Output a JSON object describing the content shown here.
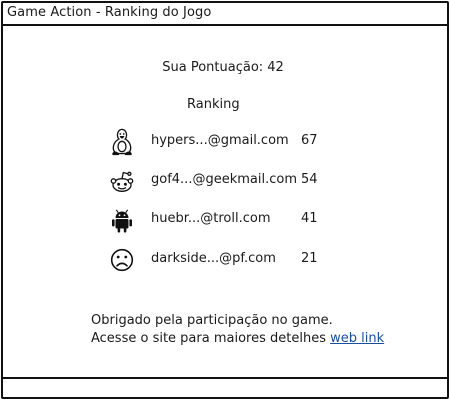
{
  "window": {
    "title": "Game Action - Ranking do Jogo"
  },
  "score": {
    "label": "Sua Pontuação:",
    "value": "42"
  },
  "ranking": {
    "title": "Ranking",
    "entries": [
      {
        "icon": "linux-tux-icon",
        "email": "hypers...@gmail.com",
        "score": "67"
      },
      {
        "icon": "reddit-alien-icon",
        "email": "gof4...@geekmail.com",
        "score": "54"
      },
      {
        "icon": "android-robot-icon",
        "email": "huebr...@troll.com",
        "score": "41"
      },
      {
        "icon": "sad-face-icon",
        "email": "darkside...@pf.com",
        "score": "21"
      }
    ]
  },
  "footer": {
    "line1": "Obrigado pela participação no game.",
    "line2": "Acesse o site para maiores detelhes",
    "link_text": "web link"
  },
  "colors": {
    "link": "#1a4fa0",
    "border": "#111111"
  }
}
